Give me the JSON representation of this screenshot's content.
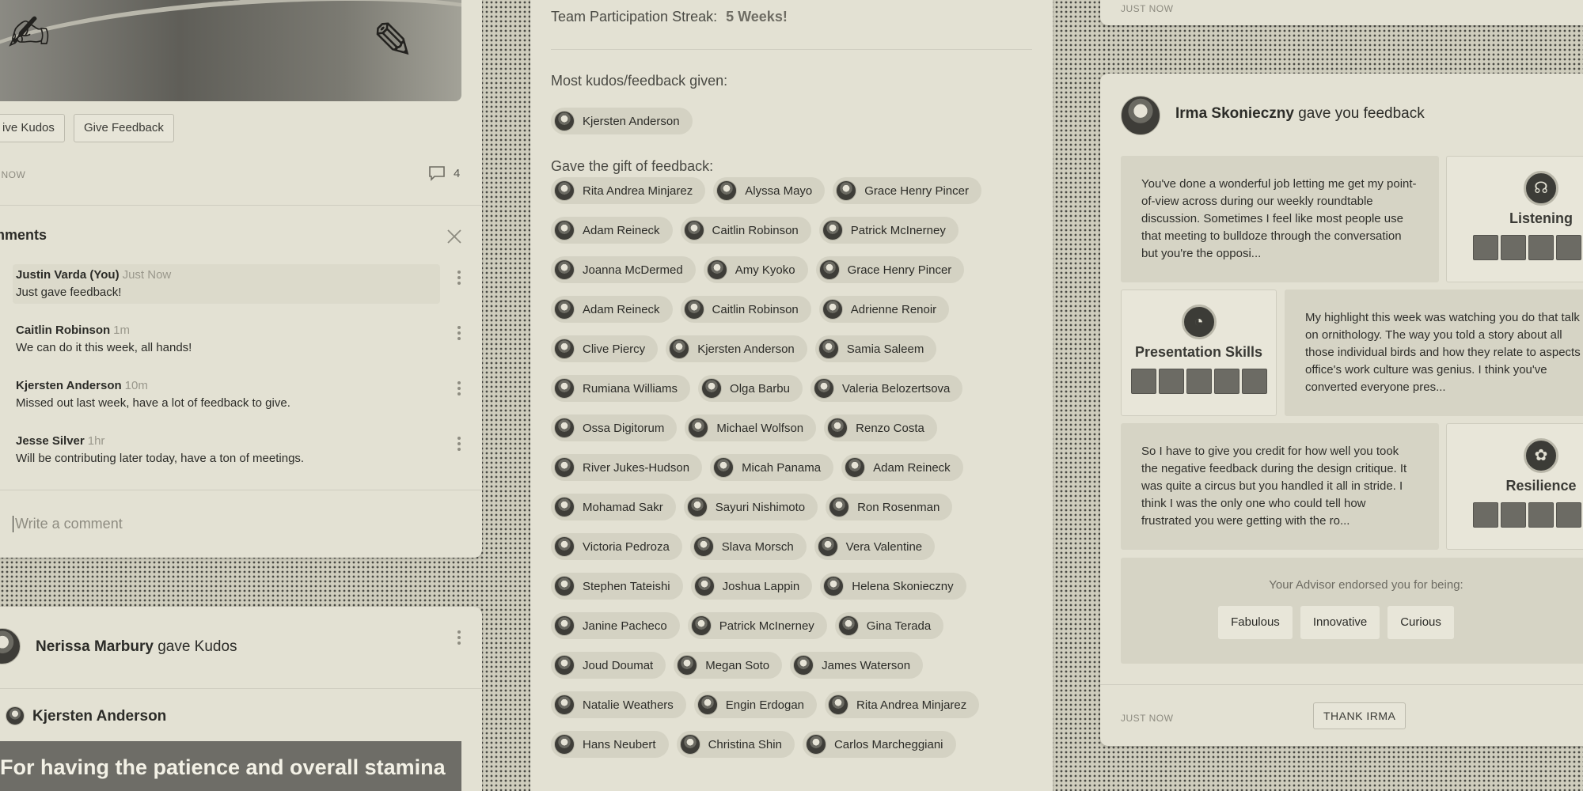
{
  "left_post": {
    "buttons": {
      "give_kudos": "ive Kudos",
      "give_feedback": "Give Feedback"
    },
    "timestamp": "T NOW",
    "comment_count": "4",
    "comments_title": "mments",
    "comments": [
      {
        "name": "Justin Varda (You)",
        "time": "Just Now",
        "text": "Just gave feedback!"
      },
      {
        "name": "Caitlin Robinson",
        "time": "1m",
        "text": "We can do it this week, all hands!"
      },
      {
        "name": "Kjersten Anderson",
        "time": "10m",
        "text": "Missed out last week, have a lot of feedback to give."
      },
      {
        "name": "Jesse Silver",
        "time": "1hr",
        "text": "Will be contributing later today, have a ton of meetings."
      }
    ],
    "comment_placeholder": "Write a comment"
  },
  "kudos_post": {
    "author": "Nerissa Marbury",
    "action": "gave Kudos",
    "recipient": "Kjersten Anderson",
    "quote": "For having the patience and overall stamina"
  },
  "team_stats": {
    "streak_label": "Team Participation Streak:",
    "streak_value": "5 Weeks!",
    "most_given_label": "Most kudos/feedback given:",
    "most_given_name": "Kjersten Anderson",
    "gift_label": "Gave the gift of feedback:",
    "gift_givers": [
      "Rita Andrea Minjarez",
      "Alyssa Mayo",
      "Grace Henry Pincer",
      "Adam Reineck",
      "Caitlin Robinson",
      "Patrick McInerney",
      "Joanna McDermed",
      "Amy Kyoko",
      "Grace Henry Pincer",
      "Adam Reineck",
      "Caitlin Robinson",
      "Adrienne Renoir",
      "Clive Piercy",
      "Kjersten Anderson",
      "Samia Saleem",
      "Rumiana Williams",
      "Olga Barbu",
      "Valeria Belozertsova",
      "Ossa Digitorum",
      "Michael Wolfson",
      "Renzo Costa",
      "River Jukes-Hudson",
      "Micah Panama",
      "Adam Reineck",
      "Mohamad Sakr",
      "Sayuri Nishimoto",
      "Ron Rosenman",
      "Victoria Pedroza",
      "Slava Morsch",
      "Vera Valentine",
      "Stephen Tateishi",
      "Joshua Lappin",
      "Helena Skonieczny",
      "Janine Pacheco",
      "Patrick McInerney",
      "Gina Terada",
      "Joud Doumat",
      "Megan Soto",
      "James Waterson",
      "Natalie Weathers",
      "Engin Erdogan",
      "Rita Andrea Minjarez",
      "Hans Neubert",
      "Christina Shin",
      "Carlos Marcheggiani"
    ]
  },
  "right_top": {
    "timestamp": "JUST NOW"
  },
  "feedback_post": {
    "author": "Irma Skonieczny",
    "action": "gave you feedback",
    "feedback_1": "You've done a wonderful job letting me get my point-of-view across during our weekly roundtable discussion. Sometimes I feel like most people use that meeting to bulldoze through the conversation but you're the opposi...",
    "skill_1": "Listening",
    "skill_2": "Presentation Skills",
    "feedback_2": "My highlight this week was watching you do that talk on ornithology. The way you told a story about all those individual birds and how they relate to aspects office's work culture was genius. I think you've converted everyone pres...",
    "feedback_3": "So I have to give you credit for how well you took the negative feedback during the design critique. It was quite a circus but you handled it all in stride. I think I was the only one who could tell how frustrated you were getting with the ro...",
    "skill_3": "Resilience",
    "endorse_label": "Your Advisor endorsed you for being:",
    "endorsements": [
      "Fabulous",
      "Innovative",
      "Curious"
    ],
    "timestamp": "JUST NOW",
    "thank_button": "THANK IRMA"
  }
}
